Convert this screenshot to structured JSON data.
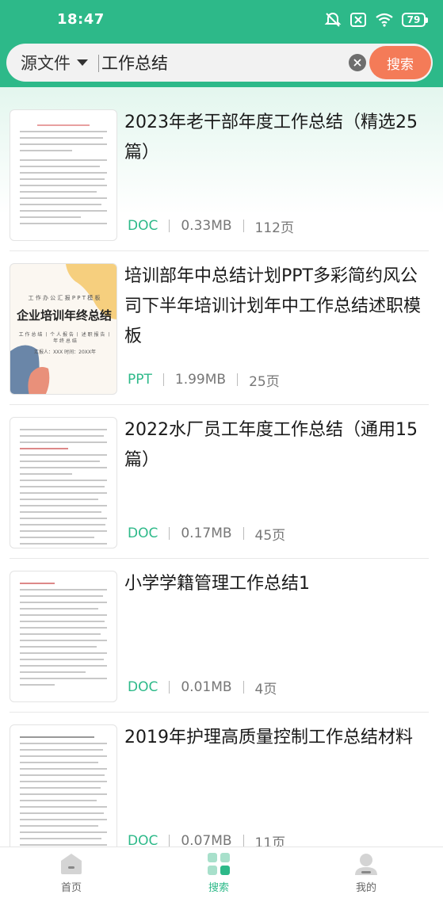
{
  "status_bar": {
    "time": "18:47",
    "battery": "79",
    "icons": [
      "alarm-off-icon",
      "no-sim-icon",
      "wifi-icon",
      "battery-icon"
    ]
  },
  "search": {
    "source_label": "源文件",
    "query": "工作总结",
    "button_label": "搜索",
    "colors": {
      "header": "#2db989",
      "button": "#f47b58"
    }
  },
  "results": [
    {
      "title": "2023年老干部年度工作总结（精选25篇）",
      "type": "DOC",
      "size": "0.33MB",
      "pages": "112页",
      "thumbnail": "doc-page"
    },
    {
      "title": "培训部年中总结计划PPT多彩简约风公司下半年培训计划年中工作总结述职模板",
      "type": "PPT",
      "size": "1.99MB",
      "pages": "25页",
      "thumbnail": "ppt-cover",
      "thumb_text": {
        "line1": "工 作 办 公 汇 报 P P T 模 板",
        "heading": "企业培训年终总结",
        "line2": "工 作 总 结 丨 个 人 报 告 丨 述 职 报 告 丨 年 终 总 结",
        "line3": "汇报人：XXX  时间：20XX年"
      }
    },
    {
      "title": "2022水厂员工年度工作总结（通用15篇）",
      "type": "DOC",
      "size": "0.17MB",
      "pages": "45页",
      "thumbnail": "doc-page"
    },
    {
      "title": "小学学籍管理工作总结1",
      "type": "DOC",
      "size": "0.01MB",
      "pages": "4页",
      "thumbnail": "doc-page"
    },
    {
      "title": "2019年护理高质量控制工作总结材料",
      "type": "DOC",
      "size": "0.07MB",
      "pages": "11页",
      "thumbnail": "doc-page"
    }
  ],
  "bottom_nav": [
    {
      "label": "首页",
      "icon": "home-icon",
      "active": false
    },
    {
      "label": "搜索",
      "icon": "grid-icon",
      "active": true
    },
    {
      "label": "我的",
      "icon": "profile-icon",
      "active": false
    }
  ]
}
